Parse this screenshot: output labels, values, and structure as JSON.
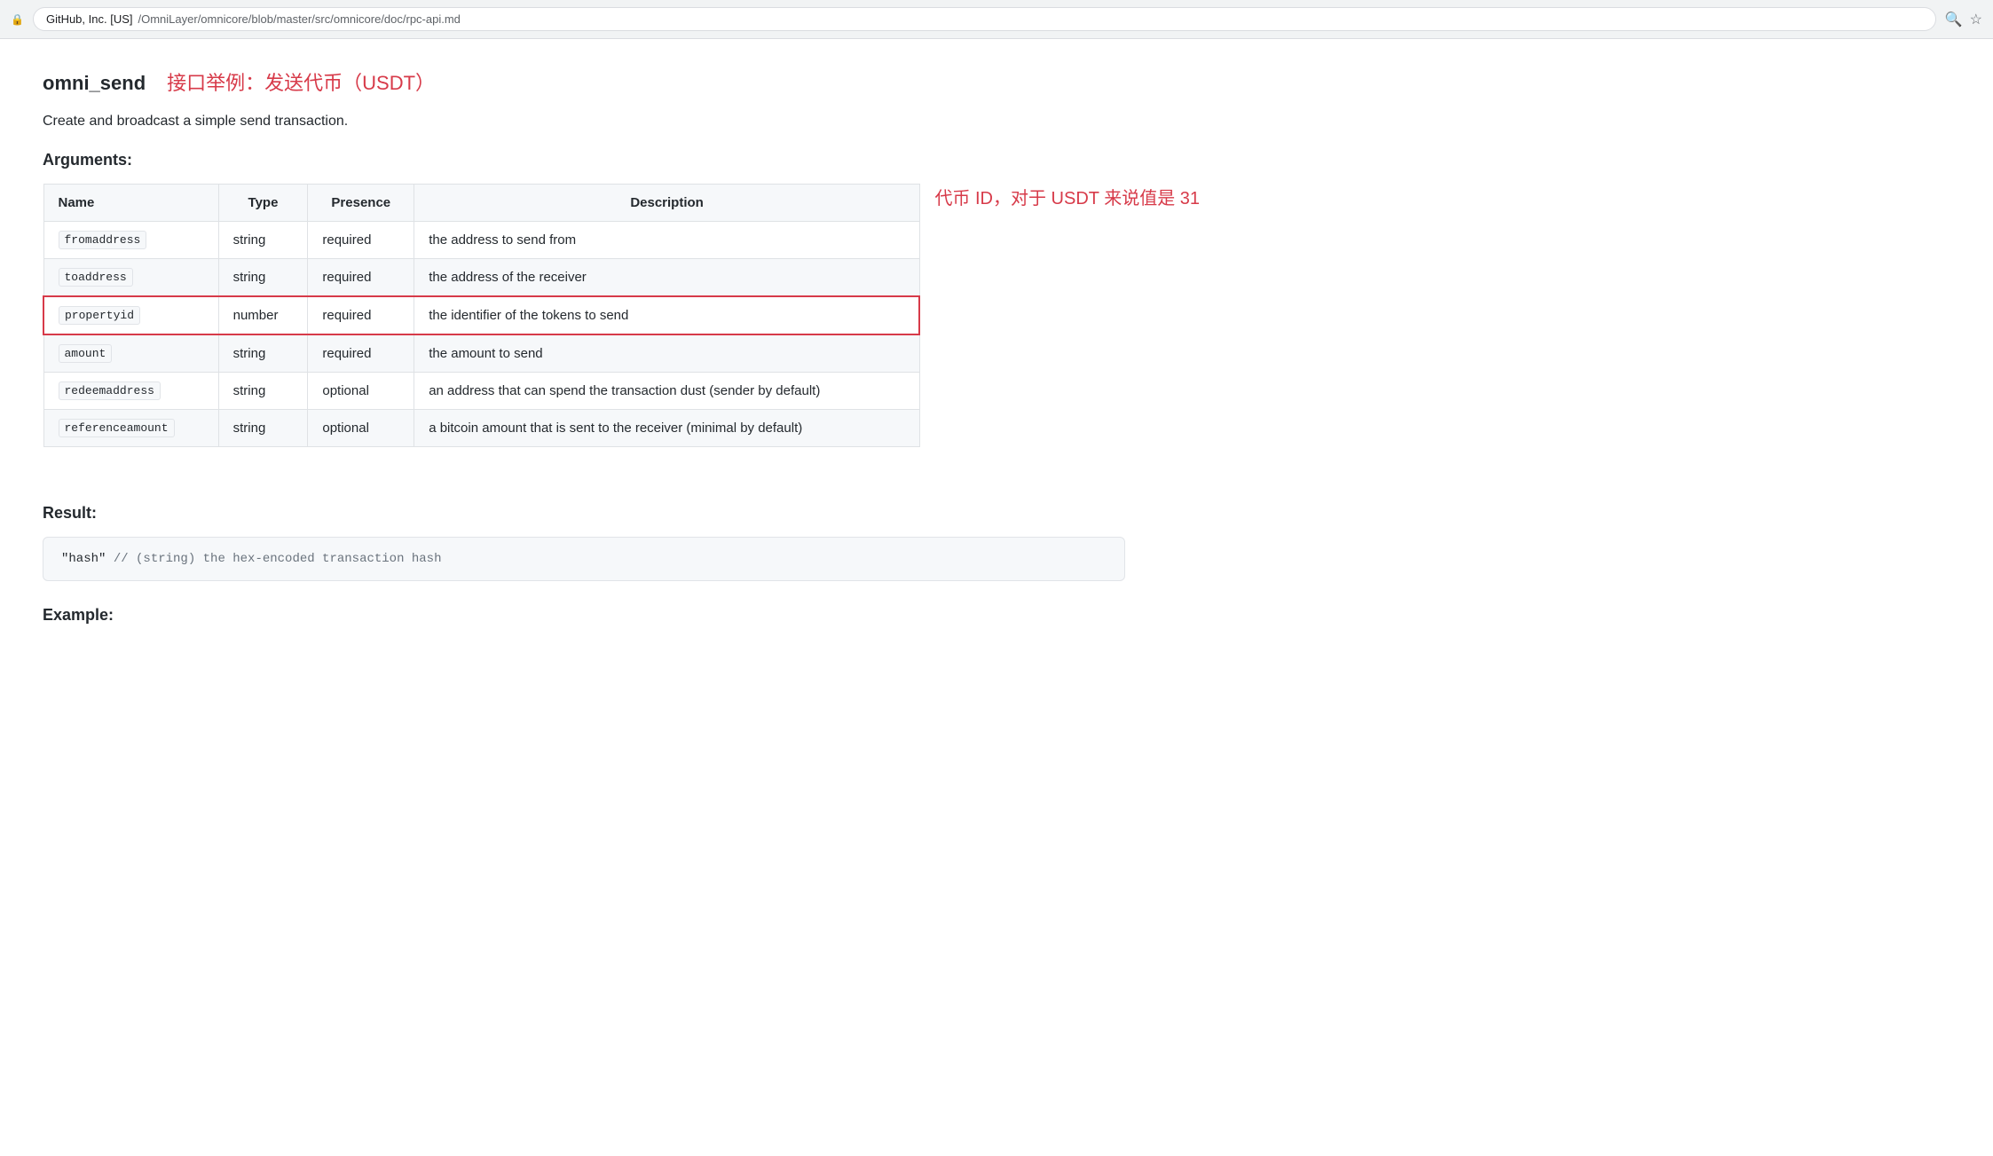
{
  "browser": {
    "secure_label": "GitHub, Inc. [US]",
    "url_full": "https://github.com/OmniLayer/omnicore/blob/master/src/omnicore/doc/rpc-api.md",
    "url_origin": "https://github.com",
    "url_path": "/OmniLayer/omnicore/blob/master/src/omnicore/doc/rpc-api.md",
    "lock_icon": "🔒"
  },
  "page": {
    "api_name": "omni_send",
    "chinese_title": "接口举例：发送代币（USDT）",
    "description": "Create and broadcast a simple send transaction.",
    "arguments_label": "Arguments:",
    "result_label": "Result:",
    "example_label": "Example:",
    "table": {
      "headers": [
        "Name",
        "Type",
        "Presence",
        "Description"
      ],
      "rows": [
        {
          "name": "fromaddress",
          "type": "string",
          "presence": "required",
          "description": "the address to send from",
          "highlighted": false
        },
        {
          "name": "toaddress",
          "type": "string",
          "presence": "required",
          "description": "the address of the receiver",
          "highlighted": false
        },
        {
          "name": "propertyid",
          "type": "number",
          "presence": "required",
          "description": "the identifier of the tokens to send",
          "highlighted": true,
          "annotation": "代币 ID，对于 USDT 来说值是 31"
        },
        {
          "name": "amount",
          "type": "string",
          "presence": "required",
          "description": "the amount to send",
          "highlighted": false
        },
        {
          "name": "redeemaddress",
          "type": "string",
          "presence": "optional",
          "description": "an address that can spend the transaction dust (sender by default)",
          "highlighted": false
        },
        {
          "name": "referenceamount",
          "type": "string",
          "presence": "optional",
          "description": "a bitcoin amount that is sent to the receiver (minimal by default)",
          "highlighted": false
        }
      ]
    },
    "result_code": "\"hash\"  // (string) the hex-encoded transaction hash",
    "result_code_parts": {
      "hash": "\"hash\"",
      "comment": "  // (string) the hex-encoded transaction hash"
    }
  }
}
